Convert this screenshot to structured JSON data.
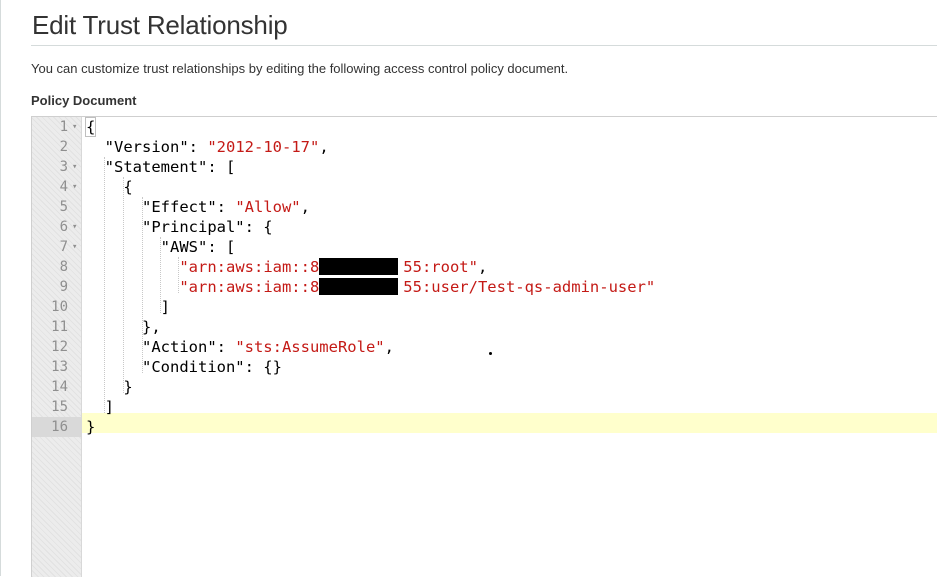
{
  "page": {
    "title": "Edit Trust Relationship",
    "description": "You can customize trust relationships by editing the following access control policy document.",
    "section_label": "Policy Document"
  },
  "editor": {
    "line_numbers": [
      "1",
      "2",
      "3",
      "4",
      "5",
      "6",
      "7",
      "8",
      "9",
      "10",
      "11",
      "12",
      "13",
      "14",
      "15",
      "16"
    ],
    "active_line": 16,
    "lines": [
      {
        "parts": [
          {
            "t": "{",
            "s": false
          }
        ]
      },
      {
        "parts": [
          {
            "t": "  \"Version\": ",
            "s": false
          },
          {
            "t": "\"2012-10-17\"",
            "s": true
          },
          {
            "t": ",",
            "s": false
          }
        ]
      },
      {
        "parts": [
          {
            "t": "  \"Statement\": [",
            "s": false
          }
        ]
      },
      {
        "parts": [
          {
            "t": "    {",
            "s": false
          }
        ]
      },
      {
        "parts": [
          {
            "t": "      \"Effect\": ",
            "s": false
          },
          {
            "t": "\"Allow\"",
            "s": true
          },
          {
            "t": ",",
            "s": false
          }
        ]
      },
      {
        "parts": [
          {
            "t": "      \"Principal\": {",
            "s": false
          }
        ]
      },
      {
        "parts": [
          {
            "t": "        \"AWS\": [",
            "s": false
          }
        ]
      },
      {
        "parts": [
          {
            "t": "          ",
            "s": false
          },
          {
            "t": "\"arn:aws:iam::86        55:root\"",
            "s": true
          },
          {
            "t": ",",
            "s": false
          }
        ]
      },
      {
        "parts": [
          {
            "t": "          ",
            "s": false
          },
          {
            "t": "\"arn:aws:iam::86        55:user/Test-qs-admin-user\"",
            "s": true
          }
        ]
      },
      {
        "parts": [
          {
            "t": "        ]",
            "s": false
          }
        ]
      },
      {
        "parts": [
          {
            "t": "      },",
            "s": false
          }
        ]
      },
      {
        "parts": [
          {
            "t": "      \"Action\": ",
            "s": false
          },
          {
            "t": "\"sts:AssumeRole\"",
            "s": true
          },
          {
            "t": ",",
            "s": false
          }
        ]
      },
      {
        "parts": [
          {
            "t": "      \"Condition\": {}",
            "s": false
          }
        ]
      },
      {
        "parts": [
          {
            "t": "    }",
            "s": false
          }
        ]
      },
      {
        "parts": [
          {
            "t": "  ]",
            "s": false
          }
        ]
      },
      {
        "parts": [
          {
            "t": "}",
            "s": false
          }
        ]
      }
    ],
    "fold_lines": [
      1,
      3,
      4,
      6,
      7
    ],
    "fold_glyph": "▾",
    "colors": {
      "string": "#c41a16",
      "active_line": "#ffffcc",
      "gutter": "#ececec"
    }
  }
}
